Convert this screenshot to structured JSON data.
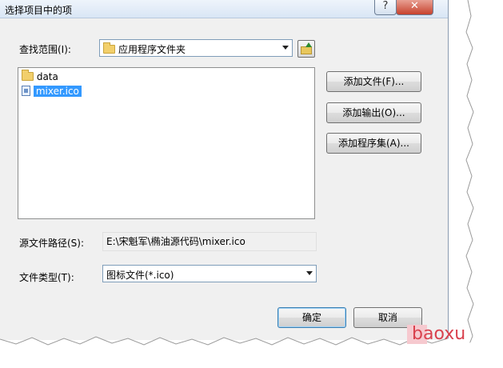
{
  "window": {
    "title": "选择项目中的项",
    "help_label": "?",
    "close_label": "✕"
  },
  "look_in": {
    "label": "查找范围(I):",
    "value": "应用程序文件夹"
  },
  "file_list": [
    {
      "name": "data",
      "icon": "folder-icon",
      "selected": false
    },
    {
      "name": "mixer.ico",
      "icon": "file-icon",
      "selected": true
    }
  ],
  "side_buttons": {
    "add_file": "添加文件(F)...",
    "add_output": "添加输出(O)...",
    "add_assembly": "添加程序集(A)..."
  },
  "source_path": {
    "label": "源文件路径(S):",
    "value": "E:\\宋魁军\\椭油源代码\\mixer.ico"
  },
  "file_type": {
    "label": "文件类型(T):",
    "value": "图标文件(*.ico)"
  },
  "footer": {
    "ok_label": "确定",
    "cancel_label": "取消"
  },
  "watermark": "baoxu"
}
